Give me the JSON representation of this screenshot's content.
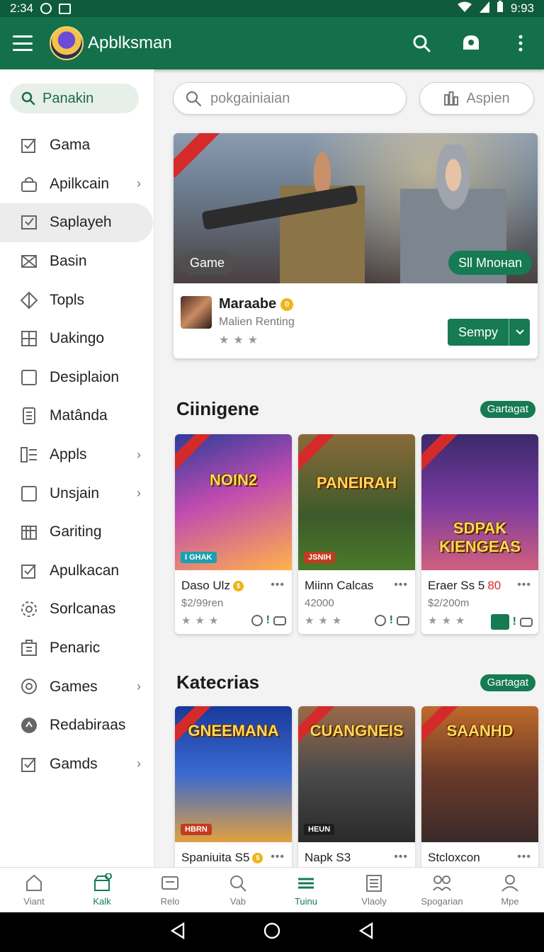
{
  "status": {
    "time_left": "2:34",
    "time_right": "9:93"
  },
  "app": {
    "title": "Apblksman"
  },
  "sidebar": {
    "search_label": "Panakin",
    "items": [
      {
        "label": "Gama",
        "icon": "checkbox-icon"
      },
      {
        "label": "Apilkcain",
        "icon": "lock-icon",
        "chevron": true
      },
      {
        "label": "Saplayeh",
        "icon": "shield-check-icon",
        "active": true
      },
      {
        "label": "Basin",
        "icon": "envelope-icon"
      },
      {
        "label": "Topls",
        "icon": "diamond-icon"
      },
      {
        "label": "Uakingo",
        "icon": "grid-icon"
      },
      {
        "label": "Desiplaion",
        "icon": "square-icon"
      },
      {
        "label": "Matânda",
        "icon": "document-icon"
      },
      {
        "label": "Appls",
        "icon": "list-icon",
        "chevron": true
      },
      {
        "label": "Unsjain",
        "icon": "square-icon",
        "chevron": true
      },
      {
        "label": "Gariting",
        "icon": "calendar-icon"
      },
      {
        "label": "Apulkacan",
        "icon": "checkbox-icon"
      },
      {
        "label": "Sorlcanas",
        "icon": "gear-icon"
      },
      {
        "label": "Penaric",
        "icon": "building-icon"
      },
      {
        "label": "Games",
        "icon": "chat-icon",
        "chevron": true
      },
      {
        "label": "Redabiraas",
        "icon": "badge-icon"
      },
      {
        "label": "Gamds",
        "icon": "checkbox-icon",
        "chevron": true
      }
    ]
  },
  "search": {
    "placeholder": "pokgainiaian",
    "filter_label": "Aspien"
  },
  "hero": {
    "chip_left": "Game",
    "chip_right": "Sll Mnoнan",
    "name": "Maraabe",
    "subtitle": "Malien Renting",
    "button_label": "Sempy"
  },
  "sections": [
    {
      "title": "Ciinigene",
      "tag": "Gartagat",
      "cards": [
        {
          "art_title": "NOIN2",
          "badge": "I GHAK",
          "name": "Daso Ulz",
          "price": "$2/99ren",
          "coin": true
        },
        {
          "art_title": "PANEIRAH",
          "badge": "JSNIH",
          "name": "Miinn Calcas",
          "price": "42000"
        },
        {
          "art_title": "SDPAK KIENGEAS",
          "badge": "",
          "name": "Eraer Ss 5",
          "name_accent": "80",
          "price": "$2/200m",
          "highlight": true
        }
      ]
    },
    {
      "title": "Katecrias",
      "tag": "Gartagat",
      "cards": [
        {
          "art_title": "GNEEMANA",
          "badge": "HBRN",
          "name": "Spaniuita S5",
          "coin": true
        },
        {
          "art_title": "CUANGNEIS",
          "badge": "HEUN",
          "name": "Napk S3"
        },
        {
          "art_title": "SAANHD",
          "badge": "",
          "name": "Stcloxcon"
        }
      ]
    }
  ],
  "bottom_tabs": [
    {
      "label": "Viant",
      "icon": "home-icon"
    },
    {
      "label": "Kalk",
      "icon": "store-icon",
      "active": true
    },
    {
      "label": "Relo",
      "icon": "tv-icon"
    },
    {
      "label": "Vab",
      "icon": "search-icon"
    },
    {
      "label": "Tuinu",
      "icon": "menu-lines-icon",
      "active": true
    },
    {
      "label": "Vlaoly",
      "icon": "newspaper-icon"
    },
    {
      "label": "Spogarian",
      "icon": "people-icon"
    },
    {
      "label": "Mpe",
      "icon": "person-icon"
    }
  ],
  "colors": {
    "primary": "#13704b",
    "accent": "#167a52",
    "sidebar_active": "#ececec"
  }
}
